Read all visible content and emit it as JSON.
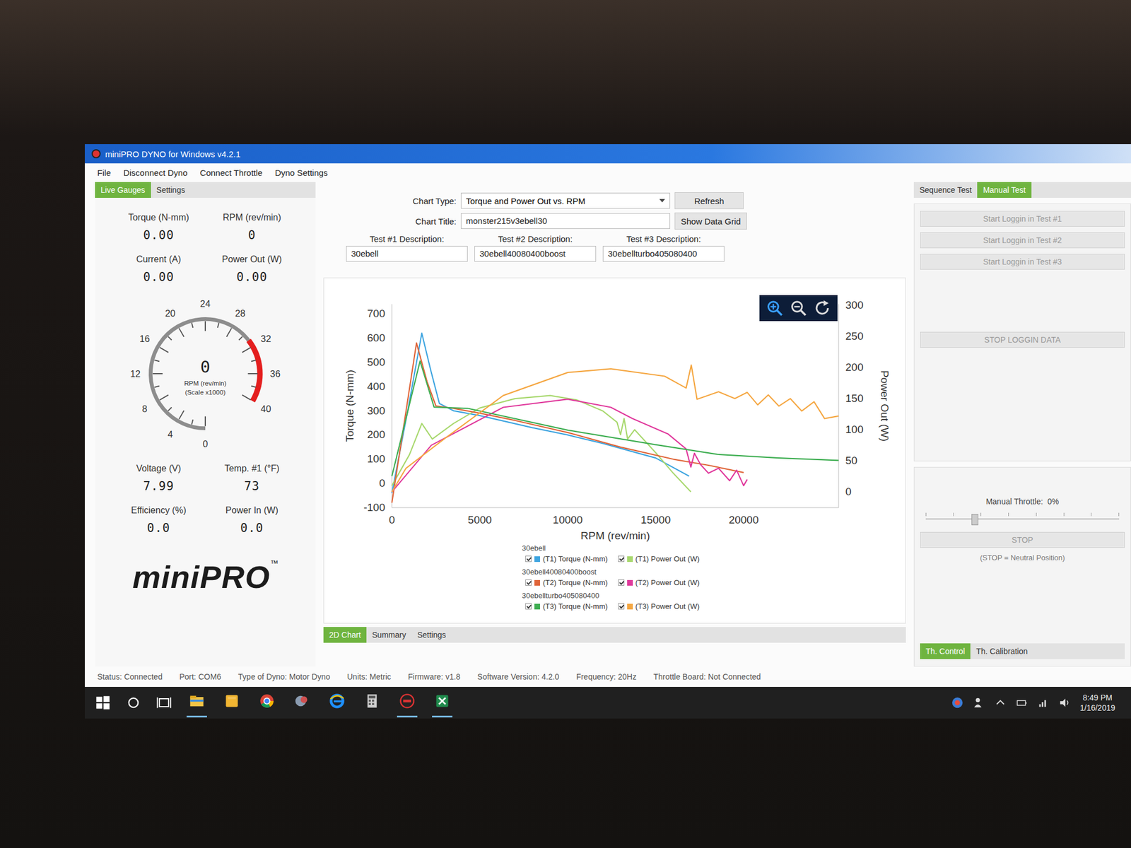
{
  "window": {
    "title": "miniPRO DYNO for Windows v4.2.1"
  },
  "menu": [
    "File",
    "Disconnect Dyno",
    "Connect Throttle",
    "Dyno Settings"
  ],
  "left_tabs": [
    {
      "label": "Live Gauges",
      "selected": true
    },
    {
      "label": "Settings",
      "selected": false
    }
  ],
  "readouts_top": [
    {
      "label": "Torque (N-mm)",
      "value": "0.00"
    },
    {
      "label": "RPM (rev/min)",
      "value": "0"
    },
    {
      "label": "Current (A)",
      "value": "0.00"
    },
    {
      "label": "Power Out (W)",
      "value": "0.00"
    }
  ],
  "dial": {
    "reading": "0",
    "label": "RPM (rev/min)",
    "scale": "(Scale x1000)",
    "ticks": [
      "0",
      "4",
      "8",
      "12",
      "16",
      "20",
      "24",
      "28",
      "32",
      "36",
      "40"
    ],
    "redline_from": 31
  },
  "readouts_bottom": [
    {
      "label": "Voltage (V)",
      "value": "7.99"
    },
    {
      "label": "Temp. #1 (°F)",
      "value": "73"
    },
    {
      "label": "Efficiency (%)",
      "value": "0.0"
    },
    {
      "label": "Power In (W)",
      "value": "0.0"
    }
  ],
  "logo": {
    "text": "miniPRO",
    "mark": "™"
  },
  "chart_type": {
    "label": "Chart Type:",
    "value": "Torque and Power Out vs. RPM"
  },
  "refresh_button": "Refresh",
  "chart_title": {
    "label": "Chart Title:",
    "value": "monster215v3ebell30"
  },
  "data_grid_button": "Show Data Grid",
  "test_descriptions": [
    {
      "label": "Test #1 Description:",
      "value": "30ebell"
    },
    {
      "label": "Test #2 Description:",
      "value": "30ebell40080400boost"
    },
    {
      "label": "Test #3 Description:",
      "value": "30ebellturbo405080400"
    }
  ],
  "chart": {
    "y_left_title": "Torque (N-mm)",
    "y_right_title": "Power Out (W)",
    "x_title": "RPM (rev/min)",
    "y_left_ticks": [
      "700",
      "600",
      "500",
      "400",
      "300",
      "200",
      "100",
      "0",
      "-100"
    ],
    "y_right_ticks": [
      "300",
      "250",
      "200",
      "150",
      "100",
      "50",
      "0"
    ],
    "x_ticks": [
      "0",
      "5000",
      "10000",
      "15000",
      "20000"
    ],
    "tests": [
      {
        "name": "30ebell",
        "series": [
          {
            "label": "(T1) Torque (N-mm)",
            "axis": "torque",
            "color": "#3fa5e0",
            "checked": true,
            "rpm": [
              0,
              900,
              1700,
              2200,
              2700,
              3500,
              5000,
              6500,
              8000,
              10000,
              12000,
              14000,
              15000,
              16900
            ],
            "values": [
              -40,
              300,
              620,
              470,
              330,
              300,
              280,
              255,
              230,
              200,
              165,
              125,
              105,
              30
            ]
          },
          {
            "label": "(T1) Power Out (W)",
            "axis": "power",
            "color": "#a8d86e",
            "checked": true,
            "rpm": [
              0,
              1000,
              1700,
              2300,
              3500,
              5000,
              7000,
              9000,
              10500,
              12000,
              12800,
              13000,
              13200,
              13400,
              13800,
              15000,
              16000,
              17000
            ],
            "values": [
              10,
              60,
              110,
              85,
              110,
              135,
              150,
              155,
              148,
              130,
              112,
              92,
              118,
              85,
              100,
              63,
              30,
              0
            ]
          }
        ]
      },
      {
        "name": "30ebell40080400boost",
        "series": [
          {
            "label": "(T2) Torque (N-mm)",
            "axis": "torque",
            "color": "#e0663a",
            "checked": true,
            "rpm": [
              0,
              700,
              1400,
              2000,
              2500,
              3500,
              5000,
              7000,
              10000,
              13000,
              16000,
              18000,
              20000
            ],
            "values": [
              -80,
              250,
              580,
              420,
              320,
              310,
              290,
              260,
              210,
              150,
              100,
              75,
              45
            ]
          },
          {
            "label": "(T2) Power Out (W)",
            "axis": "power",
            "color": "#e0399c",
            "checked": true,
            "rpm": [
              0,
              2240,
              6330,
              10000,
              12450,
              13670,
              15710,
              16730,
              17000,
              17200,
              17550,
              18000,
              18570,
              19200,
              19600,
              20000,
              20200
            ],
            "values": [
              0,
              75,
              136,
              149,
              136,
              118,
              93,
              69,
              40,
              62,
              44,
              30,
              38,
              18,
              35,
              10,
              20
            ]
          }
        ]
      },
      {
        "name": "30ebellturbo405080400",
        "series": [
          {
            "label": "(T3) Torque (N-mm)",
            "axis": "torque",
            "color": "#3fae52",
            "checked": true,
            "rpm": [
              0,
              1600,
              2400,
              4300,
              10000,
              15000,
              18500,
              22000,
              25400
            ],
            "values": [
              30,
              505,
              315,
              310,
              220,
              160,
              120,
              105,
              95
            ]
          },
          {
            "label": "(T3) Power Out (W)",
            "axis": "power",
            "color": "#f5a742",
            "checked": true,
            "rpm": [
              0,
              800,
              3060,
              6330,
              10000,
              12450,
              15510,
              16730,
              17020,
              17350,
              18570,
              19500,
              20200,
              20800,
              21400,
              22000,
              22650,
              23300,
              24000,
              24600,
              25400
            ],
            "values": [
              0,
              38,
              87,
              155,
              192,
              198,
              186,
              167,
              204,
              149,
              161,
              150,
              160,
              140,
              156,
              138,
              150,
              130,
              145,
              118,
              122
            ]
          }
        ]
      }
    ]
  },
  "chart_tabs": [
    {
      "label": "2D Chart",
      "selected": true
    },
    {
      "label": "Summary",
      "selected": false
    },
    {
      "label": "Settings",
      "selected": false
    }
  ],
  "right_tabs": [
    {
      "label": "Sequence Test",
      "selected": false
    },
    {
      "label": "Manual Test",
      "selected": true
    }
  ],
  "log_buttons": [
    {
      "label": "Start Loggin in Test #1",
      "disabled": true
    },
    {
      "label": "Start Loggin in Test #2",
      "disabled": true
    },
    {
      "label": "Start Loggin in Test #3",
      "disabled": true
    }
  ],
  "stop_logging_button": {
    "label": "STOP LOGGIN DATA",
    "disabled": true
  },
  "throttle": {
    "label": "Manual Throttle:",
    "reading": "0%",
    "level": 0.25,
    "stop_button": "STOP",
    "note": "(STOP = Neutral Position)"
  },
  "throttle_tabs": [
    {
      "label": "Th. Control",
      "selected": true
    },
    {
      "label": "Th. Calibration",
      "selected": false
    }
  ],
  "status_bar": [
    "Status: Connected",
    "Port: COM6",
    "Type of Dyno: Motor Dyno",
    "Units: Metric",
    "Firmware: v1.8",
    "Software Version: 4.2.0",
    "Frequency: 20Hz",
    "Throttle Board: Not Connected"
  ],
  "taskbar": {
    "apps": [
      {
        "kind": "explorer",
        "running": true
      },
      {
        "kind": "notes",
        "running": false
      },
      {
        "kind": "chrome",
        "running": false
      },
      {
        "kind": "tool",
        "running": false
      },
      {
        "kind": "edge",
        "running": false
      },
      {
        "kind": "calculator",
        "running": false
      },
      {
        "kind": "dyno",
        "running": true
      },
      {
        "kind": "excel",
        "running": true
      }
    ],
    "time": "8:49 PM",
    "date": "1/16/2019"
  }
}
